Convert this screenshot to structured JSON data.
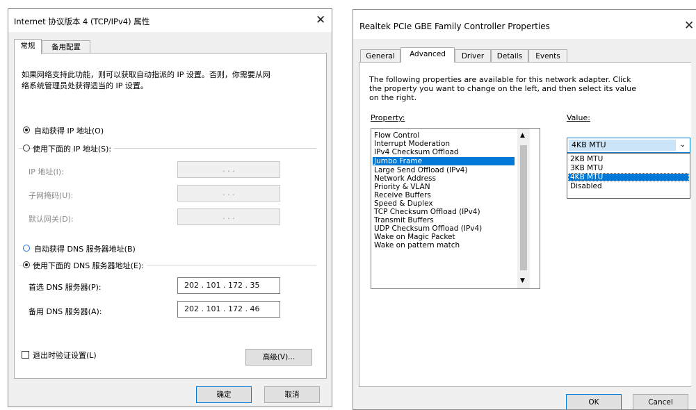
{
  "left": {
    "title": "Internet 协议版本 4 (TCP/IPv4) 属性",
    "tabs": [
      "常规",
      "备用配置"
    ],
    "description_line1": "如果网络支持此功能，则可以获取自动指派的 IP 设置。否则，你需要从网",
    "description_line2": "络系统管理员处获得适当的 IP 设置。",
    "auto_ip_label": "自动获得 IP 地址(O)",
    "manual_ip_label": "使用下面的 IP 地址(S):",
    "ip_address_label": "IP 地址(I):",
    "subnet_label": "子网掩码(U):",
    "gateway_label": "默认网关(D):",
    "empty_ip": ".       .       .",
    "auto_dns_label": "自动获得 DNS 服务器地址(B)",
    "manual_dns_label": "使用下面的 DNS 服务器地址(E):",
    "preferred_dns_label": "首选 DNS 服务器(P):",
    "preferred_dns_value": "202 . 101 . 172 . 35",
    "alternate_dns_label": "备用 DNS 服务器(A):",
    "alternate_dns_value": "202 . 101 . 172 . 46",
    "validate_label": "退出时验证设置(L)",
    "advanced_button": "高级(V)...",
    "ok_button": "确定",
    "cancel_button": "取消"
  },
  "right": {
    "title": "Realtek PCIe GBE Family Controller Properties",
    "tabs": [
      "General",
      "Advanced",
      "Driver",
      "Details",
      "Events"
    ],
    "description_line1": "The following properties are available for this network adapter. Click",
    "description_line2": "the property you want to change on the left, and then select its value",
    "description_line3": "on the right.",
    "property_label": "Property:",
    "value_label": "Value:",
    "properties": [
      "Flow Control",
      "Interrupt Moderation",
      "IPv4 Checksum Offload",
      "Jumbo Frame",
      "Large Send Offload (IPv4)",
      "Network Address",
      "Priority & VLAN",
      "Receive Buffers",
      "Speed & Duplex",
      "TCP Checksum Offload (IPv4)",
      "Transmit Buffers",
      "UDP Checksum Offload (IPv4)",
      "Wake on Magic Packet",
      "Wake on pattern match"
    ],
    "selected_property": "Jumbo Frame",
    "value_selected": "4KB MTU",
    "value_options": [
      "2KB MTU",
      "3KB MTU",
      "4KB MTU",
      "Disabled"
    ],
    "ok_button": "OK",
    "cancel_button": "Cancel"
  },
  "colors": {
    "accent": "#0078d7",
    "dialog_bg": "#f0f0f0"
  }
}
